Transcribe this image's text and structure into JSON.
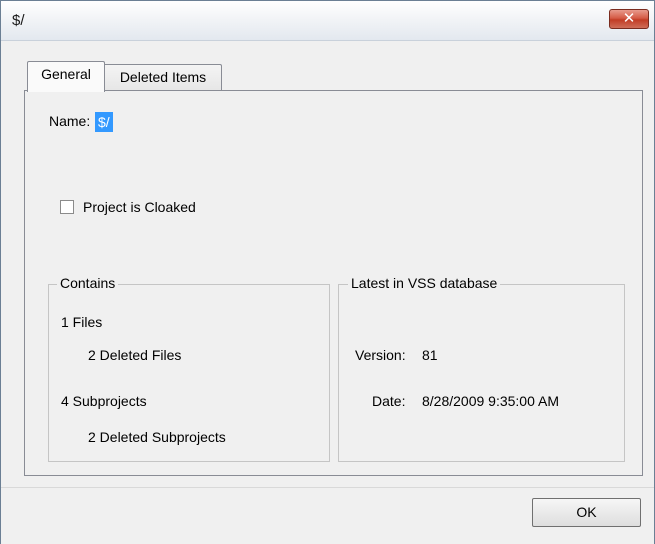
{
  "window": {
    "title": "$/",
    "close_icon": "close-icon",
    "close_glyph": "✕"
  },
  "tabs": [
    {
      "label": "General",
      "active": true
    },
    {
      "label": "Deleted Items",
      "active": false
    }
  ],
  "general": {
    "name_label": "Name:",
    "name_value": "$/",
    "cloaked_label": "Project is Cloaked",
    "cloaked_checked": false
  },
  "contains": {
    "caption": "Contains",
    "files": "1 Files",
    "deleted_files": "2 Deleted Files",
    "subprojects": "4 Subprojects",
    "deleted_subprojects": "2 Deleted Subprojects"
  },
  "latest": {
    "caption": "Latest in VSS database",
    "version_label": "Version:",
    "version_value": "81",
    "date_label": "Date:",
    "date_value": "8/28/2009 9:35:00 AM"
  },
  "footer": {
    "ok_label": "OK"
  },
  "colors": {
    "selection": "#3399ff",
    "close_button": "#c13c25",
    "dialog_background": "#f0f0f0"
  }
}
